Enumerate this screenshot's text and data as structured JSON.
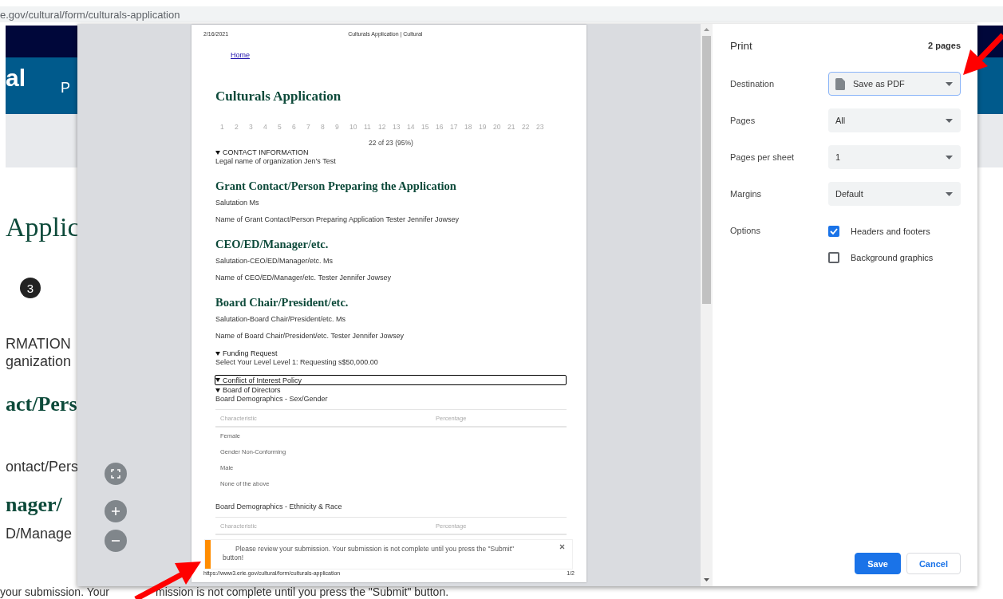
{
  "browser": {
    "url": "e.gov/cultural/form/culturals-application"
  },
  "background_page": {
    "site_name": "al",
    "nav_link": "P",
    "title": "Applic",
    "step": "3",
    "lines": [
      {
        "kind": "label",
        "text": "RMATION"
      },
      {
        "kind": "label",
        "text": "ganization"
      },
      {
        "kind": "heading",
        "text": "act/Pers"
      },
      {
        "kind": "label",
        "text": "ontact/Pers"
      },
      {
        "kind": "heading",
        "text": "nager/"
      },
      {
        "kind": "label",
        "text": "D/Manage"
      }
    ],
    "notice": [
      "your submission. Your",
      "mission is not complete until you press the \"Submit\" button."
    ]
  },
  "print_dialog": {
    "preview": {
      "page": {
        "header_date": "2/16/2021",
        "header_title": "Culturals Application | Cultural",
        "home_link": "Home",
        "title": "Culturals Application",
        "steps": [
          "1",
          "2",
          "3",
          "4",
          "5",
          "6",
          "7",
          "8",
          "9",
          "10",
          "11",
          "12",
          "13",
          "14",
          "15",
          "16",
          "17",
          "18",
          "19",
          "20",
          "21",
          "22",
          "23"
        ],
        "progress": "22 of 23 (95%)",
        "blocks": [
          {
            "kind": "summary",
            "text": "CONTACT INFORMATION",
            "focused": false
          },
          {
            "kind": "field",
            "text": "Legal name of organization Jen's Test"
          },
          {
            "kind": "heading",
            "text": "Grant Contact/Person Preparing the Application"
          },
          {
            "kind": "field",
            "text": "Salutation Ms"
          },
          {
            "kind": "field",
            "text": "Name of Grant Contact/Person Preparing Application Tester Jennifer Jowsey"
          },
          {
            "kind": "heading",
            "text": "CEO/ED/Manager/etc."
          },
          {
            "kind": "field",
            "text": "Salutation-CEO/ED/Manager/etc. Ms"
          },
          {
            "kind": "field",
            "text": "Name of CEO/ED/Manager/etc. Tester Jennifer Jowsey"
          },
          {
            "kind": "heading",
            "text": "Board Chair/President/etc."
          },
          {
            "kind": "field",
            "text": "Salutation-Board Chair/President/etc. Ms"
          },
          {
            "kind": "field",
            "text": "Name of Board Chair/President/etc. Tester Jennifer Jowsey"
          },
          {
            "kind": "summary",
            "text": "Funding Request",
            "focused": false
          },
          {
            "kind": "field",
            "text": "Select Your Level Level 1: Requesting s$50,000.00"
          },
          {
            "kind": "summary",
            "text": "Conflict of Interest Policy",
            "focused": true
          },
          {
            "kind": "summary",
            "text": "Board of Directors",
            "focused": false
          },
          {
            "kind": "field",
            "text": "Board Demographics - Sex/Gender"
          },
          {
            "kind": "table",
            "columns": [
              "Characteristic",
              "Percentage"
            ],
            "rows": [
              "Female",
              "Gender Non-Conforming",
              "Male",
              "None of the above"
            ]
          },
          {
            "kind": "field",
            "text": "Board Demographics - Ethnicity & Race"
          },
          {
            "kind": "table",
            "columns": [
              "Characteristic",
              "Percentage"
            ]
          }
        ],
        "footer_url": "https://www3.erie.gov/cultural/form/culturals-application",
        "footer_page": "1/2"
      },
      "toast": {
        "message": "Please review your submission. Your submission is not complete until you press the \"Submit\" button!"
      }
    },
    "settings": {
      "title": "Print",
      "page_count": "2 pages",
      "fields": [
        {
          "label": "Destination",
          "value": "Save as PDF",
          "focused": true,
          "kind": "pdf"
        },
        {
          "label": "Pages",
          "value": "All",
          "focused": false,
          "kind": "plain"
        },
        {
          "label": "Pages per sheet",
          "value": "1",
          "focused": false,
          "kind": "plain"
        },
        {
          "label": "Margins",
          "value": "Default",
          "focused": false,
          "kind": "plain"
        }
      ],
      "options_label": "Options",
      "options": [
        {
          "label": "Headers and footers",
          "checked": true
        },
        {
          "label": "Background graphics",
          "checked": false
        }
      ],
      "buttons": [
        {
          "label": "Save",
          "kind": "primary"
        },
        {
          "label": "Cancel",
          "kind": "secondary"
        }
      ]
    }
  }
}
